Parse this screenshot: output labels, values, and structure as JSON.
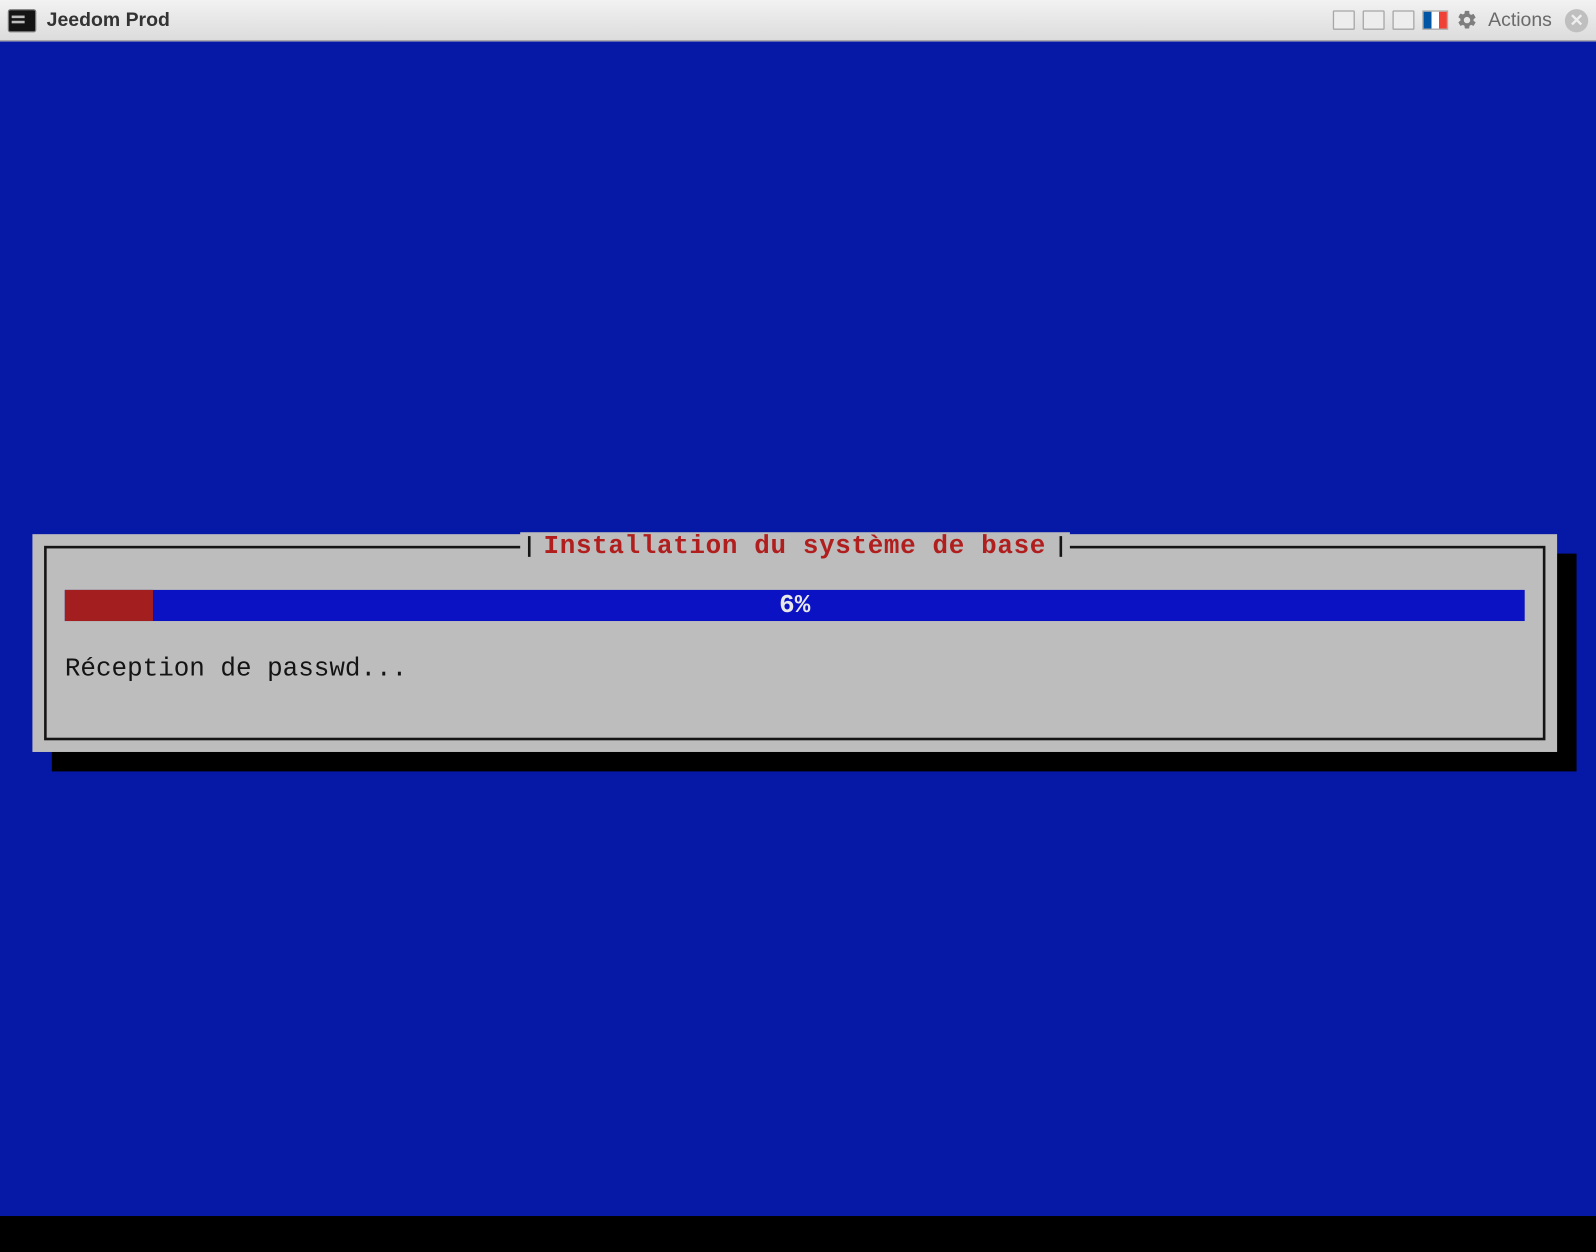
{
  "window": {
    "title": "Jeedom Prod",
    "actions_label": "Actions"
  },
  "installer": {
    "dialog_title": "Installation du système de base",
    "progress_percent": 6,
    "progress_label": "6%",
    "status_text": "Réception de passwd..."
  },
  "colors": {
    "console_bg": "#0618a6",
    "panel_bg": "#bdbdbd",
    "title_fg": "#b11e1e",
    "progress_bg": "#0a12c4",
    "progress_fill": "#a31f1f"
  }
}
